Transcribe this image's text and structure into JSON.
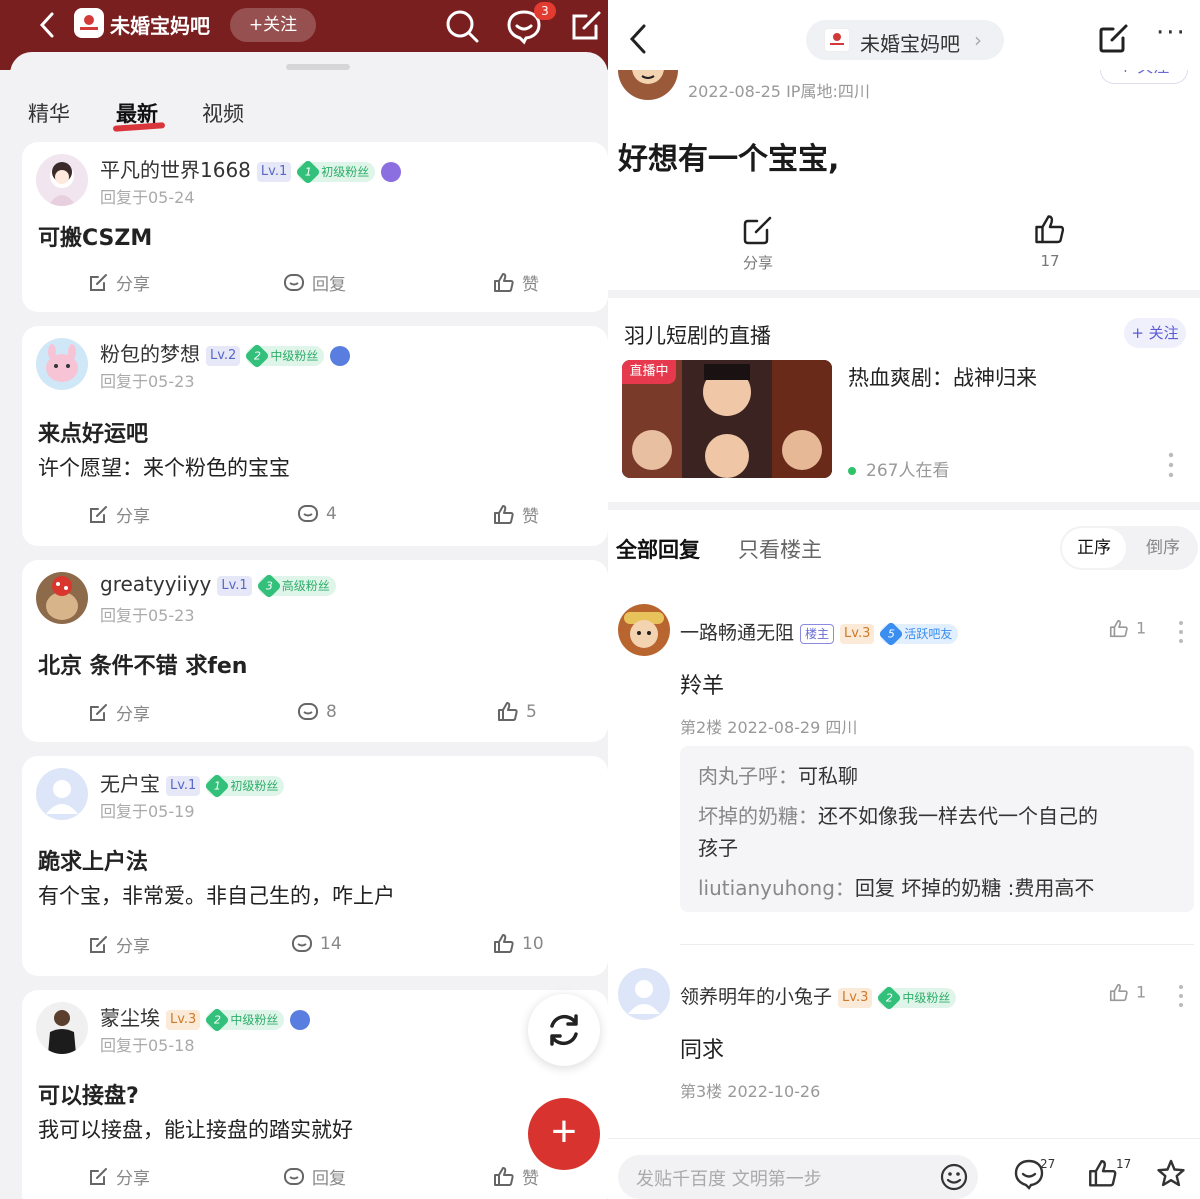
{
  "left": {
    "header": {
      "bar_name": "未婚宝妈吧",
      "follow_label": "+关注",
      "message_badge": "3"
    },
    "tabs": [
      "精华",
      "最新",
      "视频"
    ],
    "active_tab": "最新",
    "posts": [
      {
        "user": "平凡的世界1668",
        "level": "Lv.1",
        "fan_num": "1",
        "fan_label": "初级粉丝",
        "date": "回复于05-24",
        "title": "可搬CSZM",
        "body": "",
        "share": "分享",
        "comments": "回复",
        "likes": "赞"
      },
      {
        "user": "粉包的梦想",
        "level": "Lv.2",
        "fan_num": "2",
        "fan_label": "中级粉丝",
        "date": "回复于05-23",
        "title": "来点好运吧",
        "body": "许个愿望：来个粉色的宝宝",
        "share": "分享",
        "comments": "4",
        "likes": "赞"
      },
      {
        "user": "greatyyiiyy",
        "level": "Lv.1",
        "fan_num": "3",
        "fan_label": "高级粉丝",
        "date": "回复于05-23",
        "title": "北京 条件不错 求fen",
        "body": "",
        "share": "分享",
        "comments": "8",
        "likes": "5"
      },
      {
        "user": "无户宝",
        "level": "Lv.1",
        "fan_num": "1",
        "fan_label": "初级粉丝",
        "date": "回复于05-19",
        "title": "跪求上户法",
        "body": "有个宝，非常爱。非自己生的，咋上户",
        "share": "分享",
        "comments": "14",
        "likes": "10"
      },
      {
        "user": "蒙尘埃",
        "level": "Lv.3",
        "fan_num": "2",
        "fan_label": "中级粉丝",
        "date": "回复于05-18",
        "title": "可以接盘?",
        "body": "我可以接盘，能让接盘的踏实就好",
        "share": "分享",
        "comments": "回复",
        "likes": "赞"
      }
    ],
    "fab_label": "+"
  },
  "right": {
    "header": {
      "bar_name": "未婚宝妈吧",
      "more": "···"
    },
    "op": {
      "date_ip": "2022-08-25   IP属地:四川",
      "follow_partial": "+ 关注",
      "title": "好想有一个宝宝,",
      "share_label": "分享",
      "like_count": "17"
    },
    "live": {
      "streamer": "羽儿短剧的直播",
      "follow_label": "+ 关注",
      "tag": "直播中",
      "show_name": "热血爽剧：战神归来",
      "viewers": "267人在看"
    },
    "reply_tabs": {
      "all": "全部回复",
      "op_only": "只看楼主",
      "order_asc": "正序",
      "order_desc": "倒序"
    },
    "comments": [
      {
        "user": "一路畅通无阻",
        "op_tag": "楼主",
        "level": "Lv.3",
        "fan_num": "5",
        "fan_label": "活跃吧友",
        "likes": "1",
        "text": "羚羊",
        "meta": "第2楼   2022-08-29   四川",
        "replies": [
          {
            "who": "肉丸子呼：",
            "text": "可私聊"
          },
          {
            "who": "坏掉的奶糖：",
            "text": "还不如像我一样去代一个自己的"
          },
          {
            "who": "",
            "text": "孩子"
          },
          {
            "who": "liutianyuhong：",
            "text": "回复 坏掉的奶糖 :费用高不"
          }
        ]
      },
      {
        "user": "领养明年的小兔子",
        "level": "Lv.3",
        "fan_num": "2",
        "fan_label": "中级粉丝",
        "likes": "1",
        "text": "同求",
        "meta": "第3楼   2022-10-26"
      }
    ],
    "bottom": {
      "placeholder": "发贴千百度 文明第一步",
      "comment_count": "27",
      "like_count": "17"
    }
  }
}
